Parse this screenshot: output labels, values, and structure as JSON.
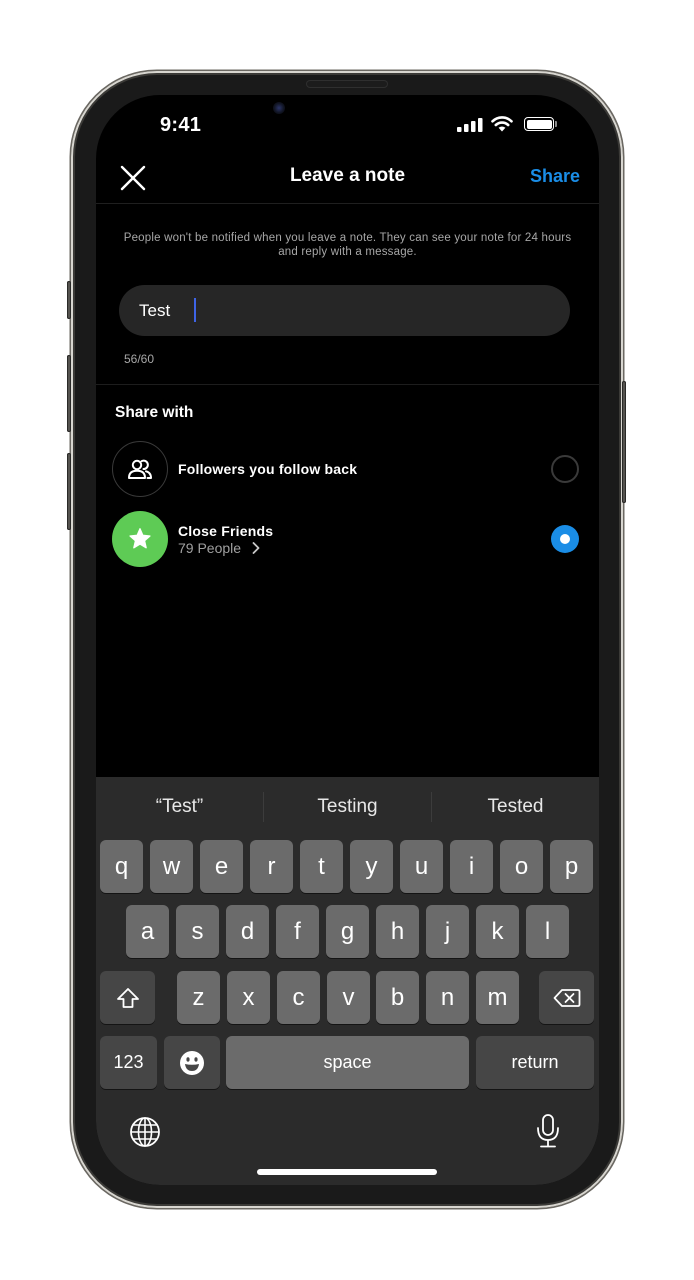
{
  "status_bar": {
    "time": "9:41",
    "icons": [
      "cellular-signal-icon",
      "wifi-icon",
      "battery-icon"
    ]
  },
  "nav": {
    "close_icon": "close-icon",
    "title": "Leave a note",
    "share_label": "Share"
  },
  "info_text": "People won't be notified when you leave a note. They can see your note for 24 hours and reply with a message.",
  "note": {
    "value": "Test",
    "char_count": "56/60"
  },
  "share_with": {
    "title": "Share with",
    "options": [
      {
        "label": "Followers you follow back",
        "sub": "",
        "icon": "people-icon",
        "selected": false
      },
      {
        "label": "Close Friends",
        "sub": "79 People",
        "icon": "star-icon",
        "selected": true
      }
    ]
  },
  "colors": {
    "accent": "#1a8de6",
    "close_friends_green": "#5ecb55",
    "background": "#000000",
    "keyboard_bg": "#2b2b2b",
    "key_bg": "#6b6b6b"
  },
  "keyboard": {
    "suggestions": [
      "“Test”",
      "Testing",
      "Tested"
    ],
    "row1": [
      "q",
      "w",
      "e",
      "r",
      "t",
      "y",
      "u",
      "i",
      "o",
      "p"
    ],
    "row2": [
      "a",
      "s",
      "d",
      "f",
      "g",
      "h",
      "j",
      "k",
      "l"
    ],
    "row3": [
      "z",
      "x",
      "c",
      "v",
      "b",
      "n",
      "m"
    ],
    "numbers_label": "123",
    "space_label": "space",
    "return_label": "return"
  }
}
